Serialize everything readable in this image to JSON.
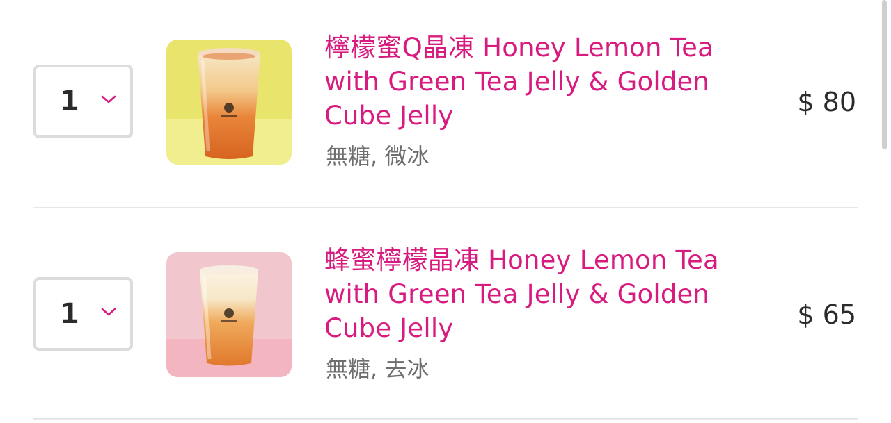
{
  "cart": {
    "items": [
      {
        "quantity": "1",
        "title": "檸檬蜜Q晶凍 Honey Lemon Tea with Green Tea Jelly & Golden Cube Jelly",
        "options": "無糖, 微冰",
        "price": "$ 80",
        "image": "honey-lemon-tea-cup"
      },
      {
        "quantity": "1",
        "title": "蜂蜜檸檬晶凍 Honey Lemon Tea with Green Tea Jelly & Golden Cube Jelly",
        "options": "無糖, 去冰",
        "price": "$ 65",
        "image": "honey-lemon-tea-cup"
      }
    ]
  },
  "colors": {
    "accent": "#d81b7f",
    "text": "#2b2b2b",
    "muted": "#6e6e6e",
    "border": "#dcdcdc",
    "divider": "#e7e7e7",
    "image_bg_1": "#e8e46a",
    "image_bg_2": "#f0c3cb"
  }
}
